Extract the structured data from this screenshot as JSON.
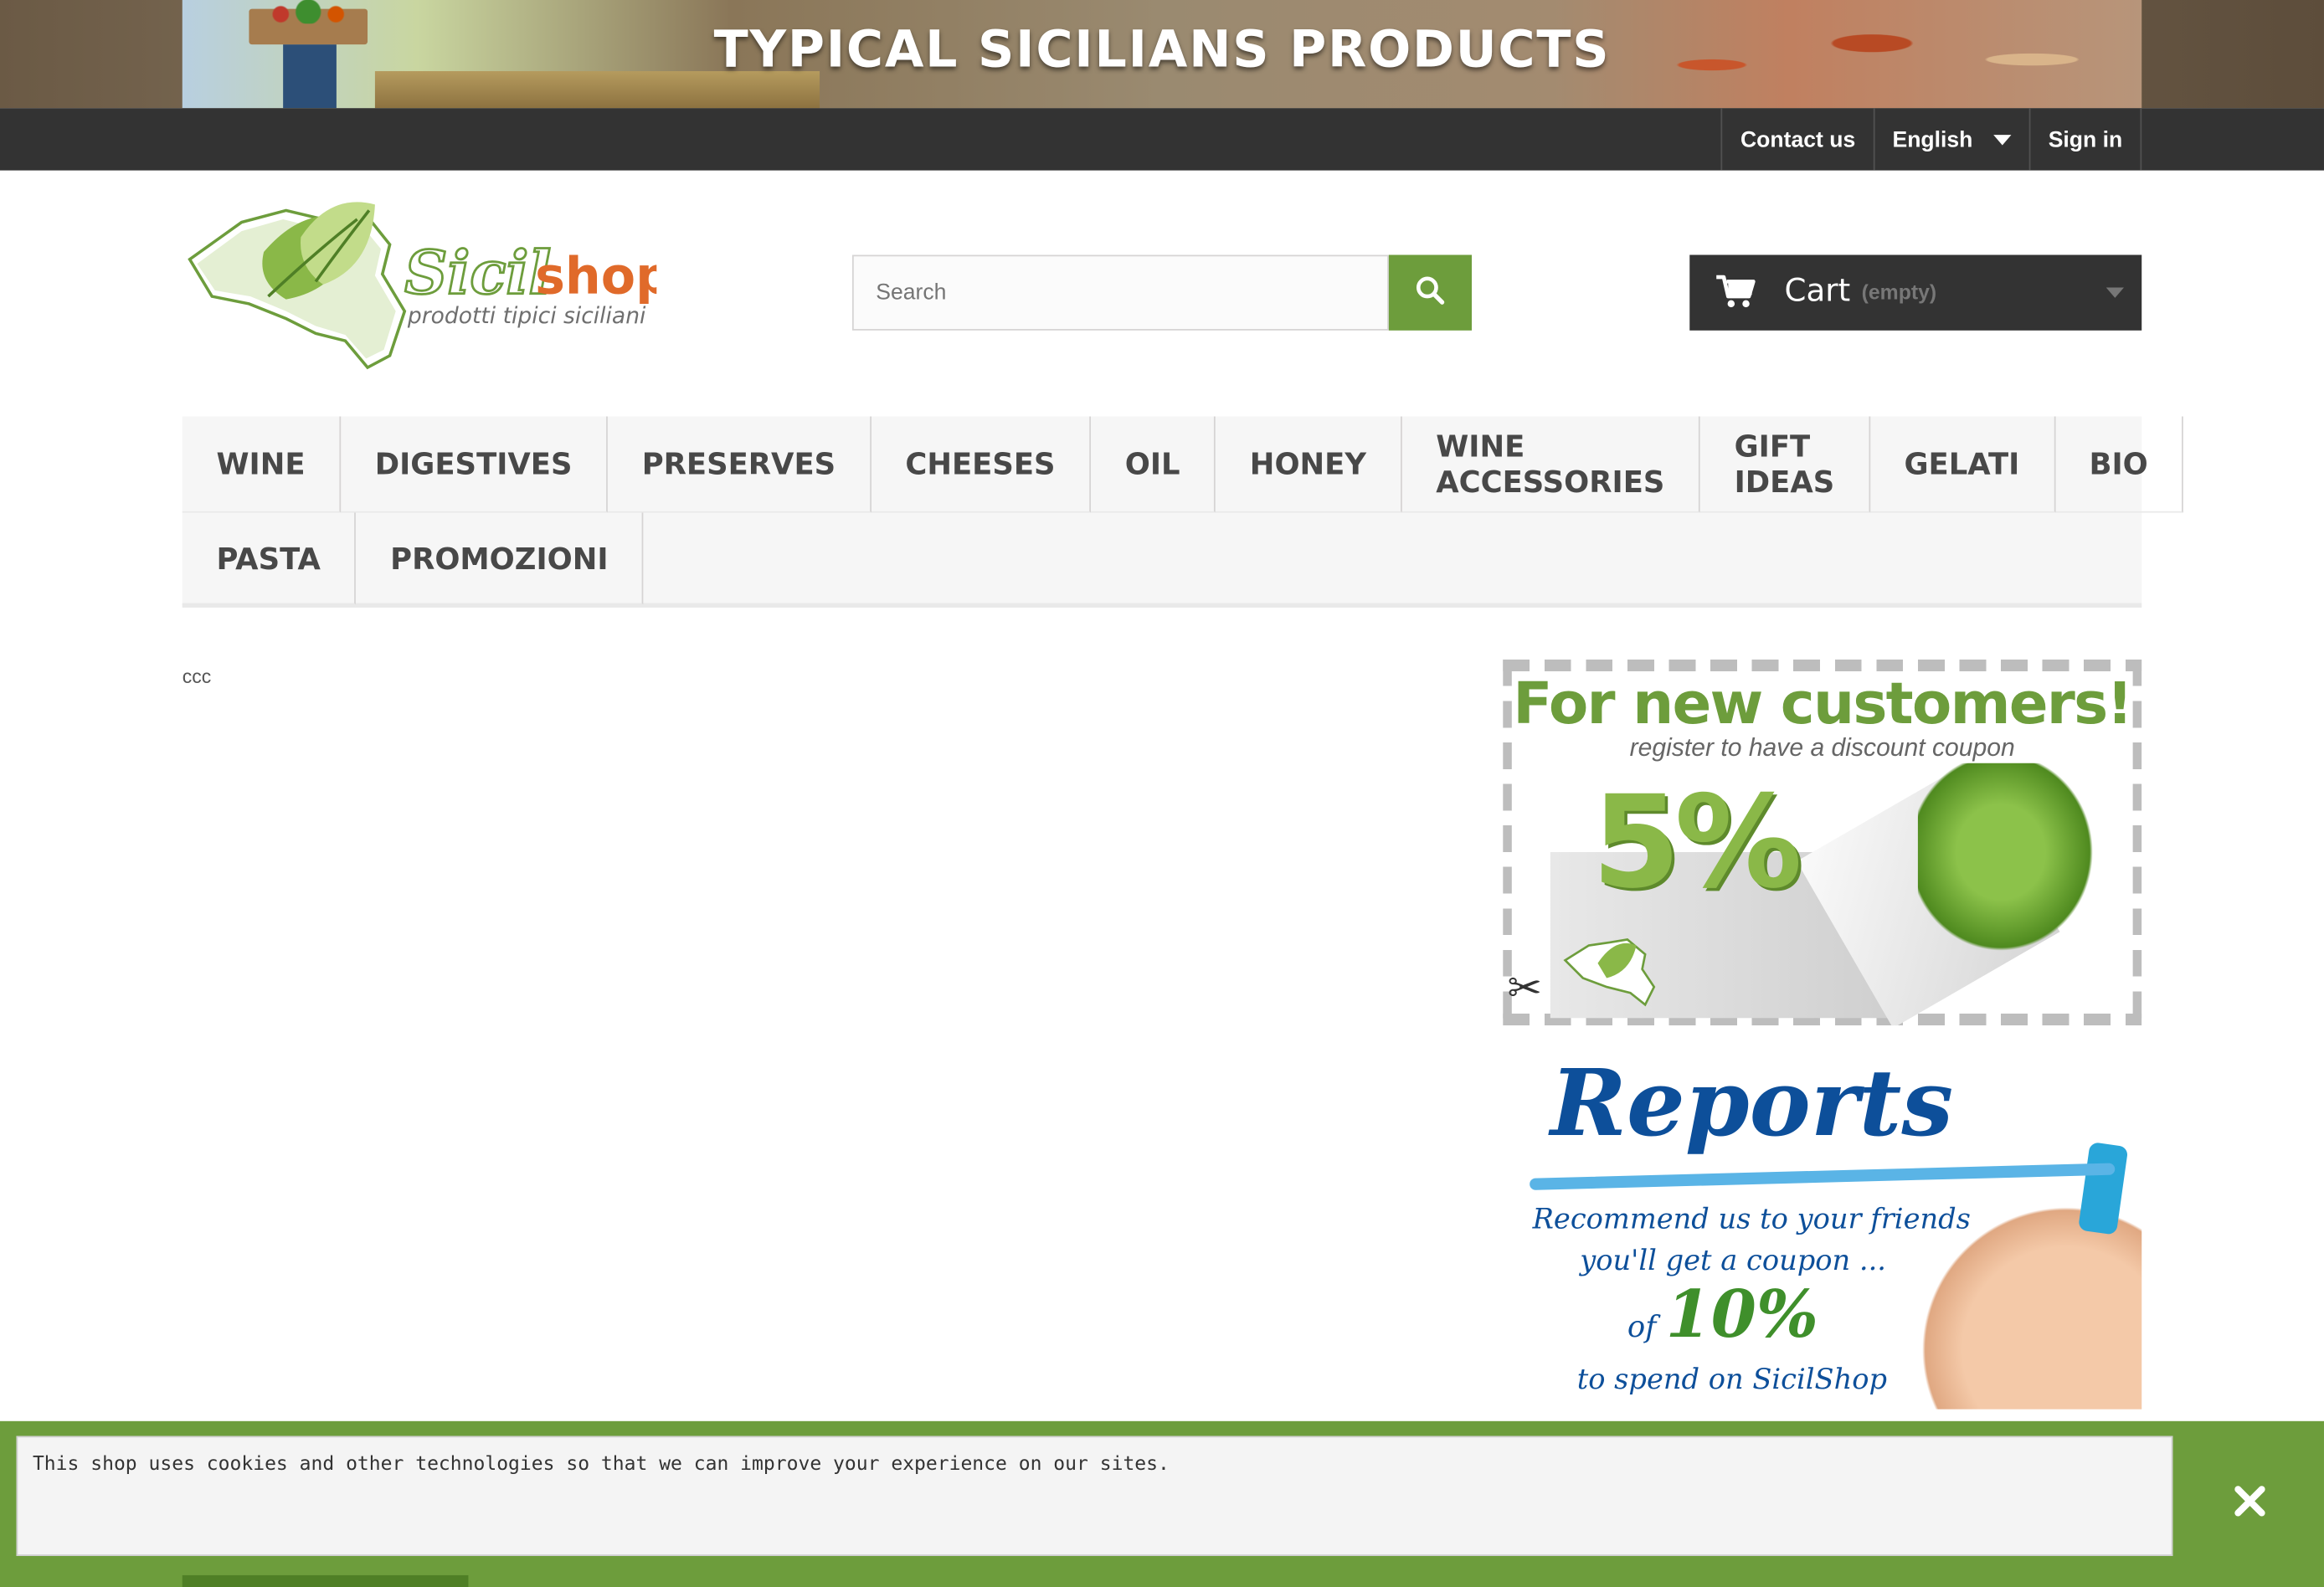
{
  "banner": {
    "title": "TYPICAL SICILIANS PRODUCTS"
  },
  "topnav": {
    "contact": "Contact us",
    "language": "English",
    "signin": "Sign in"
  },
  "logo": {
    "brand_a": "Sicil",
    "brand_b": "shop",
    "tagline": "prodotti tipici siciliani"
  },
  "search": {
    "placeholder": "Search"
  },
  "cart": {
    "label": "Cart",
    "status": "(empty)"
  },
  "menu": {
    "row1": [
      "WINE",
      "DIGESTIVES",
      "PRESERVES",
      "CHEESES",
      "OIL",
      "HONEY",
      "WINE ACCESSORIES",
      "GIFT IDEAS",
      "GELATI",
      "BIO"
    ],
    "row2": [
      "PASTA",
      "PROMOZIONI"
    ]
  },
  "content": {
    "text": "ccc"
  },
  "promo_new_customers": {
    "headline": "For new customers!",
    "sub": "register to have a discount coupon",
    "discount": "5%"
  },
  "promo_reports": {
    "headline": "Reports",
    "line1": "Recommend us to your friends",
    "line2": "you'll get a coupon ...",
    "line3_prefix": "of",
    "line3_value": "10%",
    "line4": "to spend on SicilShop"
  },
  "cookie": {
    "message": "This shop uses cookies and other technologies so that we can improve your experience on our sites."
  },
  "colors": {
    "accent_green": "#6d9d3c",
    "dark_bar": "#333333",
    "menu_bg": "#f6f6f6"
  }
}
